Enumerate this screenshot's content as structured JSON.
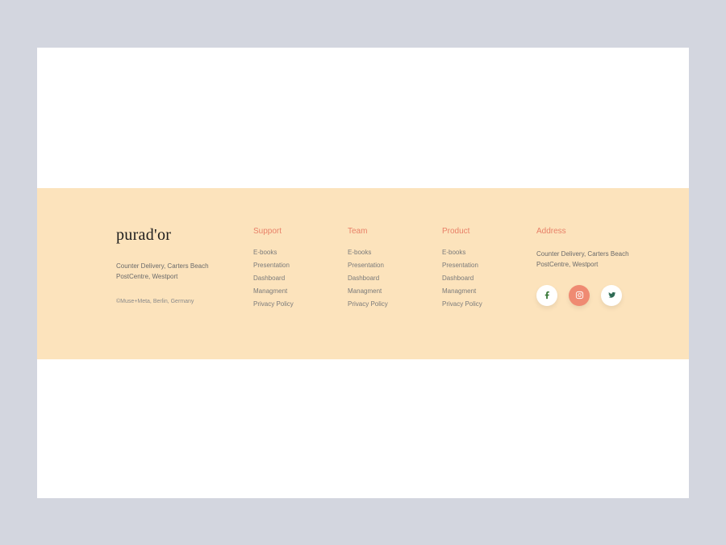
{
  "brand": {
    "logo_a": "pura",
    "logo_b": "d'or",
    "address_line1": "Counter Delivery, Carters Beach",
    "address_line2": "PostCentre, Westport",
    "maker": "©Muse+Meta, Berlin, Germany"
  },
  "columns": {
    "support": {
      "head": "Support",
      "links": [
        "E-books",
        "Presentation",
        "Dashboard",
        "Managment",
        "Privacy Policy"
      ]
    },
    "team": {
      "head": "Team",
      "links": [
        "E-books",
        "Presentation",
        "Dashboard",
        "Managment",
        "Privacy Policy"
      ]
    },
    "product": {
      "head": "Product",
      "links": [
        "E-books",
        "Presentation",
        "Dashboard",
        "Managment",
        "Privacy Policy"
      ]
    }
  },
  "address": {
    "head": "Address",
    "line1": "Counter Delivery, Carters Beach",
    "line2": "PostCentre, Westport"
  },
  "colors": {
    "page_bg": "#d3d6df",
    "card_bg": "#ffffff",
    "footer_bg": "#fce3bc",
    "accent": "#e88068",
    "social_active": "#ef8a72",
    "text_muted": "#7a7a7a"
  },
  "social": {
    "facebook": "facebook-icon",
    "instagram": "instagram-icon",
    "twitter": "twitter-icon"
  }
}
